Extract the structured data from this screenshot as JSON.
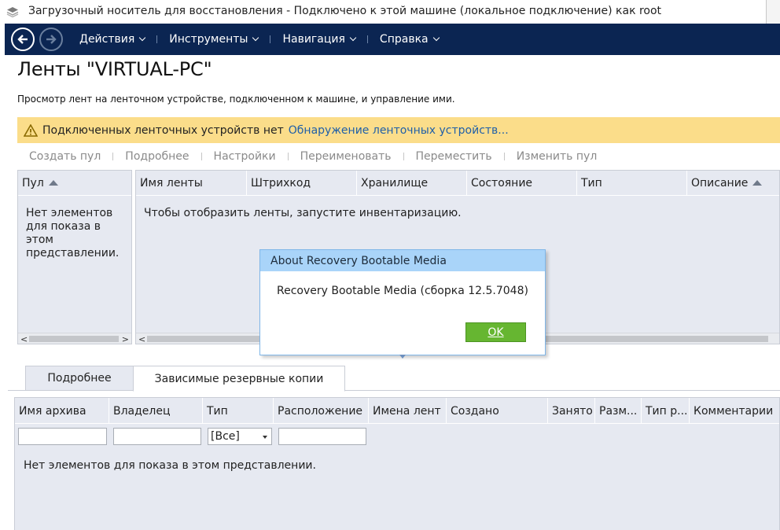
{
  "window": {
    "title": "Загрузочный носитель для восстановления - Подключено к этой машине (локальное подключение) как root"
  },
  "nav": {
    "icons": {
      "back": "arrow-left-icon",
      "forward": "arrow-right-icon"
    },
    "menu": [
      {
        "label": "Действия"
      },
      {
        "label": "Инструменты"
      },
      {
        "label": "Навигация"
      },
      {
        "label": "Справка"
      }
    ]
  },
  "page": {
    "title": "Ленты \"VIRTUAL-PC\"",
    "subtitle": "Просмотр лент на ленточном устройстве, подключенном к машине, и управление ими."
  },
  "warning": {
    "icon": "warning-triangle-icon",
    "text": "Подключенных ленточных устройств нет",
    "link": "Обнаружение ленточных устройств..."
  },
  "toolbar": {
    "create_pool": "Создать пул",
    "details": "Подробнее",
    "settings": "Настройки",
    "rename": "Переименовать",
    "move": "Переместить",
    "change_pool": "Изменить пул"
  },
  "pool_panel": {
    "header": "Пул",
    "empty": "Нет элементов для показа в этом представлении."
  },
  "tapes_panel": {
    "columns": [
      "Имя ленты",
      "Штрихкод",
      "Хранилище",
      "Состояние",
      "Тип",
      "Описание"
    ],
    "empty": "Чтобы отобразить ленты, запустите инвентаризацию."
  },
  "dialog": {
    "title": "About Recovery Bootable Media",
    "message": "Recovery Bootable Media (сборка 12.5.7048)",
    "ok": "OK"
  },
  "tabs": [
    {
      "label": "Подробнее",
      "active": false
    },
    {
      "label": "Зависимые резервные копии",
      "active": true
    }
  ],
  "archives": {
    "columns": [
      "Имя архива",
      "Владелец",
      "Тип",
      "Расположение",
      "Имена лент",
      "Создано",
      "Занято",
      "Разм...",
      "Тип р...",
      "Комментарии"
    ],
    "type_filter": "[Все]",
    "empty": "Нет элементов для показа в этом представлении."
  },
  "colors": {
    "nav_bg": "#0b2552",
    "warning_bg": "#fbdd8a",
    "link": "#1f5fa8",
    "panel_bg": "#e6e9f1",
    "dialog_title_bg": "#a9d4f9",
    "ok_button": "#66b631"
  }
}
